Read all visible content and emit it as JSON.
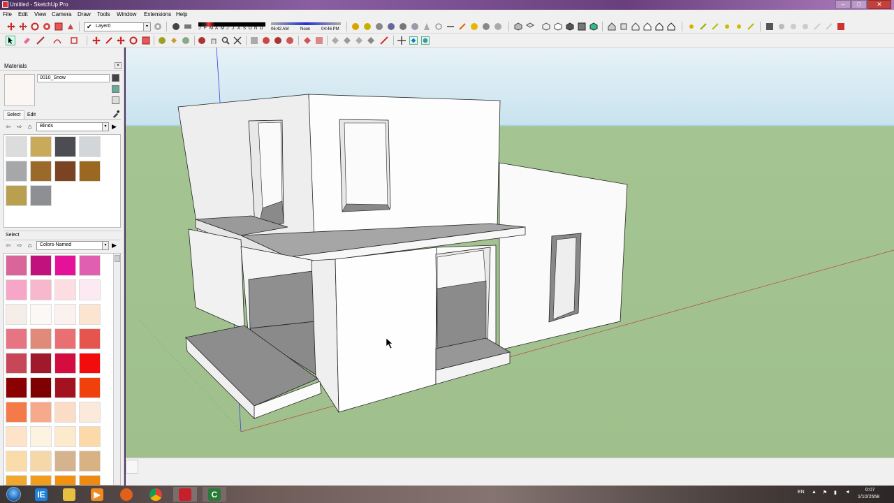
{
  "window": {
    "title": "Untitled - SketchUp Pro"
  },
  "window_controls": {
    "minimize": "–",
    "maximize": "□",
    "close": "✕"
  },
  "menu": [
    "File",
    "Edit",
    "View",
    "Camera",
    "Draw",
    "Tools",
    "Window",
    "Extensions",
    "Help"
  ],
  "toolbar": {
    "layer_check": "✔",
    "layer": "Layer0",
    "shadow_months": [
      "J",
      "F",
      "M",
      "A",
      "M",
      "J",
      "J",
      "A",
      "S",
      "O",
      "N",
      "D"
    ],
    "shadow_time_start": "06:42 AM",
    "shadow_time_noon": "Noon",
    "shadow_time_end": "04:46 PM"
  },
  "materials_panel": {
    "title": "Materials",
    "close": "✕",
    "material_name": "0010_Snow",
    "tabs": [
      "Select",
      "Edit"
    ],
    "library_top": "Blinds",
    "select_label": "Select",
    "library_bottom": "Colors-Named",
    "dropdown_arrow": "▾",
    "back_arrow": "⇦",
    "forward_arrow": "⇨",
    "home_glyph": "⌂",
    "details_glyph": "▶",
    "blinds_swatches": [
      "#dcdcdc",
      "#c9a95a",
      "#4b4d52",
      "#d3d6d8",
      "#a5a7a9",
      "#9b6a2a",
      "#7a4322",
      "#9a6820",
      "#b9a050",
      "#8e8f92"
    ],
    "color_swatches": [
      "#d9659b",
      "#c0117d",
      "#e5119a",
      "#e05fb0",
      "#f6a6c6",
      "#f7b7cc",
      "#fbdde2",
      "#fbeaf2",
      "#f5ede8",
      "#fbf8f6",
      "#fbf1ee",
      "#fbe4d0",
      "#e77482",
      "#e08a7a",
      "#ea6f72",
      "#e5544d",
      "#c74759",
      "#a0182b",
      "#d40c3f",
      "#f20c0c",
      "#8b0000",
      "#7e0000",
      "#a3131f",
      "#f0400c",
      "#f57a4a",
      "#f7a98c",
      "#fbdcc6",
      "#fbeadb",
      "#fde3c8",
      "#fdf3e1",
      "#fde9cc",
      "#fcd9a8",
      "#f9dcaa",
      "#f5d8a8",
      "#d5b38e",
      "#d9b283",
      "#f1a82c",
      "#f29d19",
      "#f29010",
      "#ef8a10"
    ]
  },
  "taskbar": {
    "apps": [
      "IE",
      "Explorer",
      "Media",
      "Firefox",
      "Chrome",
      "SketchUp",
      "Camtasia"
    ],
    "language": "EN",
    "time": "0:07",
    "date": "1/10/2558"
  }
}
